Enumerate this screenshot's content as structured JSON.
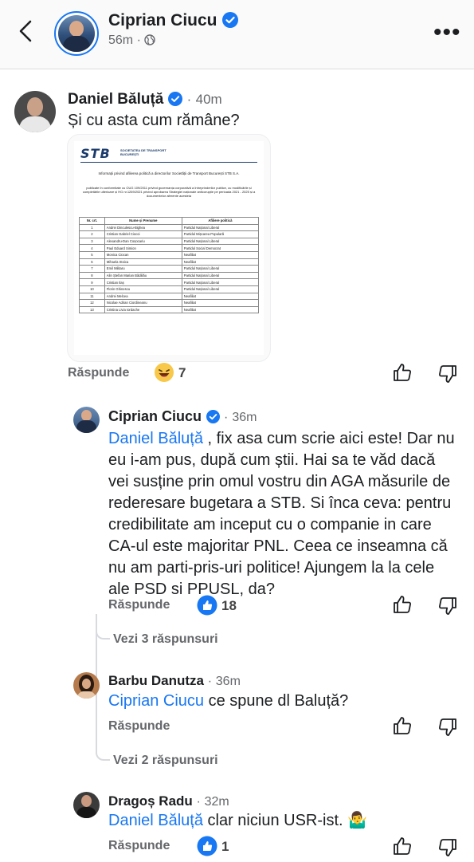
{
  "header": {
    "name": "Ciprian Ciucu",
    "time": "56m",
    "separator": "·",
    "more_icon": "more-horizontal-icon"
  },
  "comments": [
    {
      "author": "Daniel Băluță",
      "time": "40m",
      "text": "Și cu asta cum rămâne?",
      "reply_label": "Răspunde",
      "reaction_count": "7",
      "reaction_icon": "laughing-emoji-icon"
    },
    {
      "author": "Ciprian Ciucu",
      "time": "36m",
      "mention": "Daniel Băluță",
      "text": " , fix asa cum scrie aici este! Dar nu eu i-am pus, după cum știi. Hai sa te văd dacă vei susține prin omul vostru din AGA măsurile de rederesare bugetara a STB. Si încа ceva: pentru credibilitate am inceput cu o companie in care CA-ul este majoritar PNL. Ceea ce inseamna că nu am parti-pris-uri politice! Ajungem la la cele ale PSD si PPUSL, da?",
      "reply_label": "Răspunde",
      "reaction_count": "18",
      "replies_label": "Vezi 3 răspunsuri"
    },
    {
      "author": "Barbu Danutza",
      "time": "36m",
      "mention": "Ciprian Ciucu",
      "text": " ce spune dl Baluță?",
      "reply_label": "Răspunde",
      "replies_label": "Vezi 2 răspunsuri"
    },
    {
      "author": "Dragoș Radu",
      "time": "32m",
      "mention": "Daniel Băluță",
      "text": " clar niciun USR-ist. 🤷‍♂️",
      "reply_label": "Răspunde",
      "reaction_count": "1"
    }
  ],
  "document": {
    "logo_text": "STB",
    "logo_subtitle": "SOCIETATEA DE TRANSPORT BUCUREȘTI",
    "title": "Informații privind afilierea politică a directorilor Societății de Transport București STB S.A.",
    "subtitle": "publicate în conformitate cu OUG 109/2011 privind guvernanța corporativă a întreprinderilor publice, cu modificările și completările ulterioare și HG nr.1269/2021 privind aprobarea Strategiei naționale anticorupție pe perioada 2021 - 2025 și a documentelor aferente acesteia",
    "columns": [
      "Nr. crt.",
      "Nume și Prenume",
      "Afiliere politică"
    ],
    "rows": [
      [
        "1",
        "Andrei Dinculescu-Bighea",
        "Partidul Național Liberal"
      ],
      [
        "2",
        "Cristian Gabriel Ciocoi",
        "Partidul Mișcarea Populară"
      ],
      [
        "3",
        "Alexandru-Dan Coșocariu",
        "Partidul Național Liberal"
      ],
      [
        "4",
        "Paul Eduard Simion",
        "Partidul Social Democrat"
      ],
      [
        "5",
        "Monica Ciocan",
        "Neafiliat"
      ],
      [
        "6",
        "Mihaela Stoica",
        "Neafiliat"
      ],
      [
        "7",
        "Emil Militaru",
        "Partidul Național Liberal"
      ],
      [
        "8",
        "Alin Ștefan Marian Bădiliău",
        "Partidul Național Liberal"
      ],
      [
        "9",
        "Cristian Ilaș",
        "Partidul Național Liberal"
      ],
      [
        "10",
        "Florin Ghinescu",
        "Partidul Național Liberal"
      ],
      [
        "11",
        "Andrei Melcea",
        "Neafiliat"
      ],
      [
        "12",
        "Nicolae Adrian Ciordineanu",
        "Neafiliat"
      ],
      [
        "13",
        "Cristina Livia Iordache",
        "Neafiliat"
      ]
    ]
  },
  "colors": {
    "accent": "#1877f2",
    "muted_text": "#65676b",
    "header_bg": "#fafafa"
  }
}
